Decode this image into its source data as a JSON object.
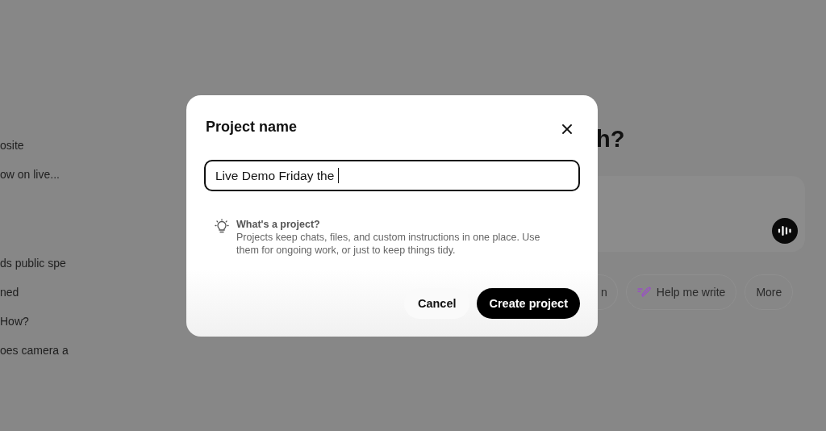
{
  "sidebar": {
    "groups": [
      {
        "items": [
          {
            "label": "osite"
          },
          {
            "label": "ow on live..."
          }
        ]
      },
      {
        "items": [
          {
            "label": "ds public spe"
          },
          {
            "label": "ned"
          },
          {
            "label": "How?"
          },
          {
            "label": "oes camera a"
          }
        ]
      }
    ]
  },
  "main": {
    "heading": "h?",
    "chips": [
      {
        "label": "n",
        "kind": "plain"
      },
      {
        "label": "Help me write",
        "kind": "write"
      },
      {
        "label": "More",
        "kind": "plain"
      }
    ]
  },
  "dialog": {
    "title": "Project name",
    "name_field": {
      "value": "Live Demo Friday the"
    },
    "tip": {
      "title": "What's a project?",
      "text": "Projects keep chats, files, and custom instructions in one place. Use them for ongoing work, or just to keep things tidy."
    },
    "buttons": [
      {
        "label": "Cancel",
        "kind": "secondary"
      },
      {
        "label": "Create project",
        "kind": "primary"
      }
    ]
  }
}
